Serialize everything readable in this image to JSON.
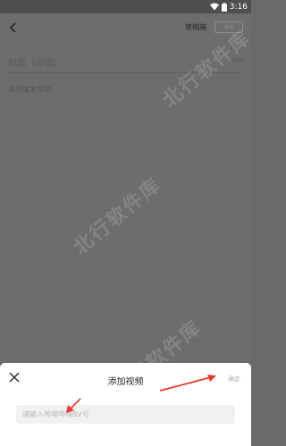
{
  "status_bar": {
    "time": "3:16",
    "icons": [
      "wifi-icon",
      "battery-icon"
    ]
  },
  "editor": {
    "drafts_label": "草稿箱",
    "publish_label": "发布",
    "title_placeholder": "标题（必填）",
    "title_counter": "0/30",
    "body_placeholder": "请尽情发挥吧..."
  },
  "sheet": {
    "title": "添加视频",
    "confirm_label": "确定",
    "input_placeholder": "请输入哔哩哔哩BV号"
  },
  "watermark": "北行软件库",
  "colors": {
    "annotation_arrow": "#e53935",
    "overlay": "#6a6a6a",
    "sheet_bg": "#ffffff"
  }
}
